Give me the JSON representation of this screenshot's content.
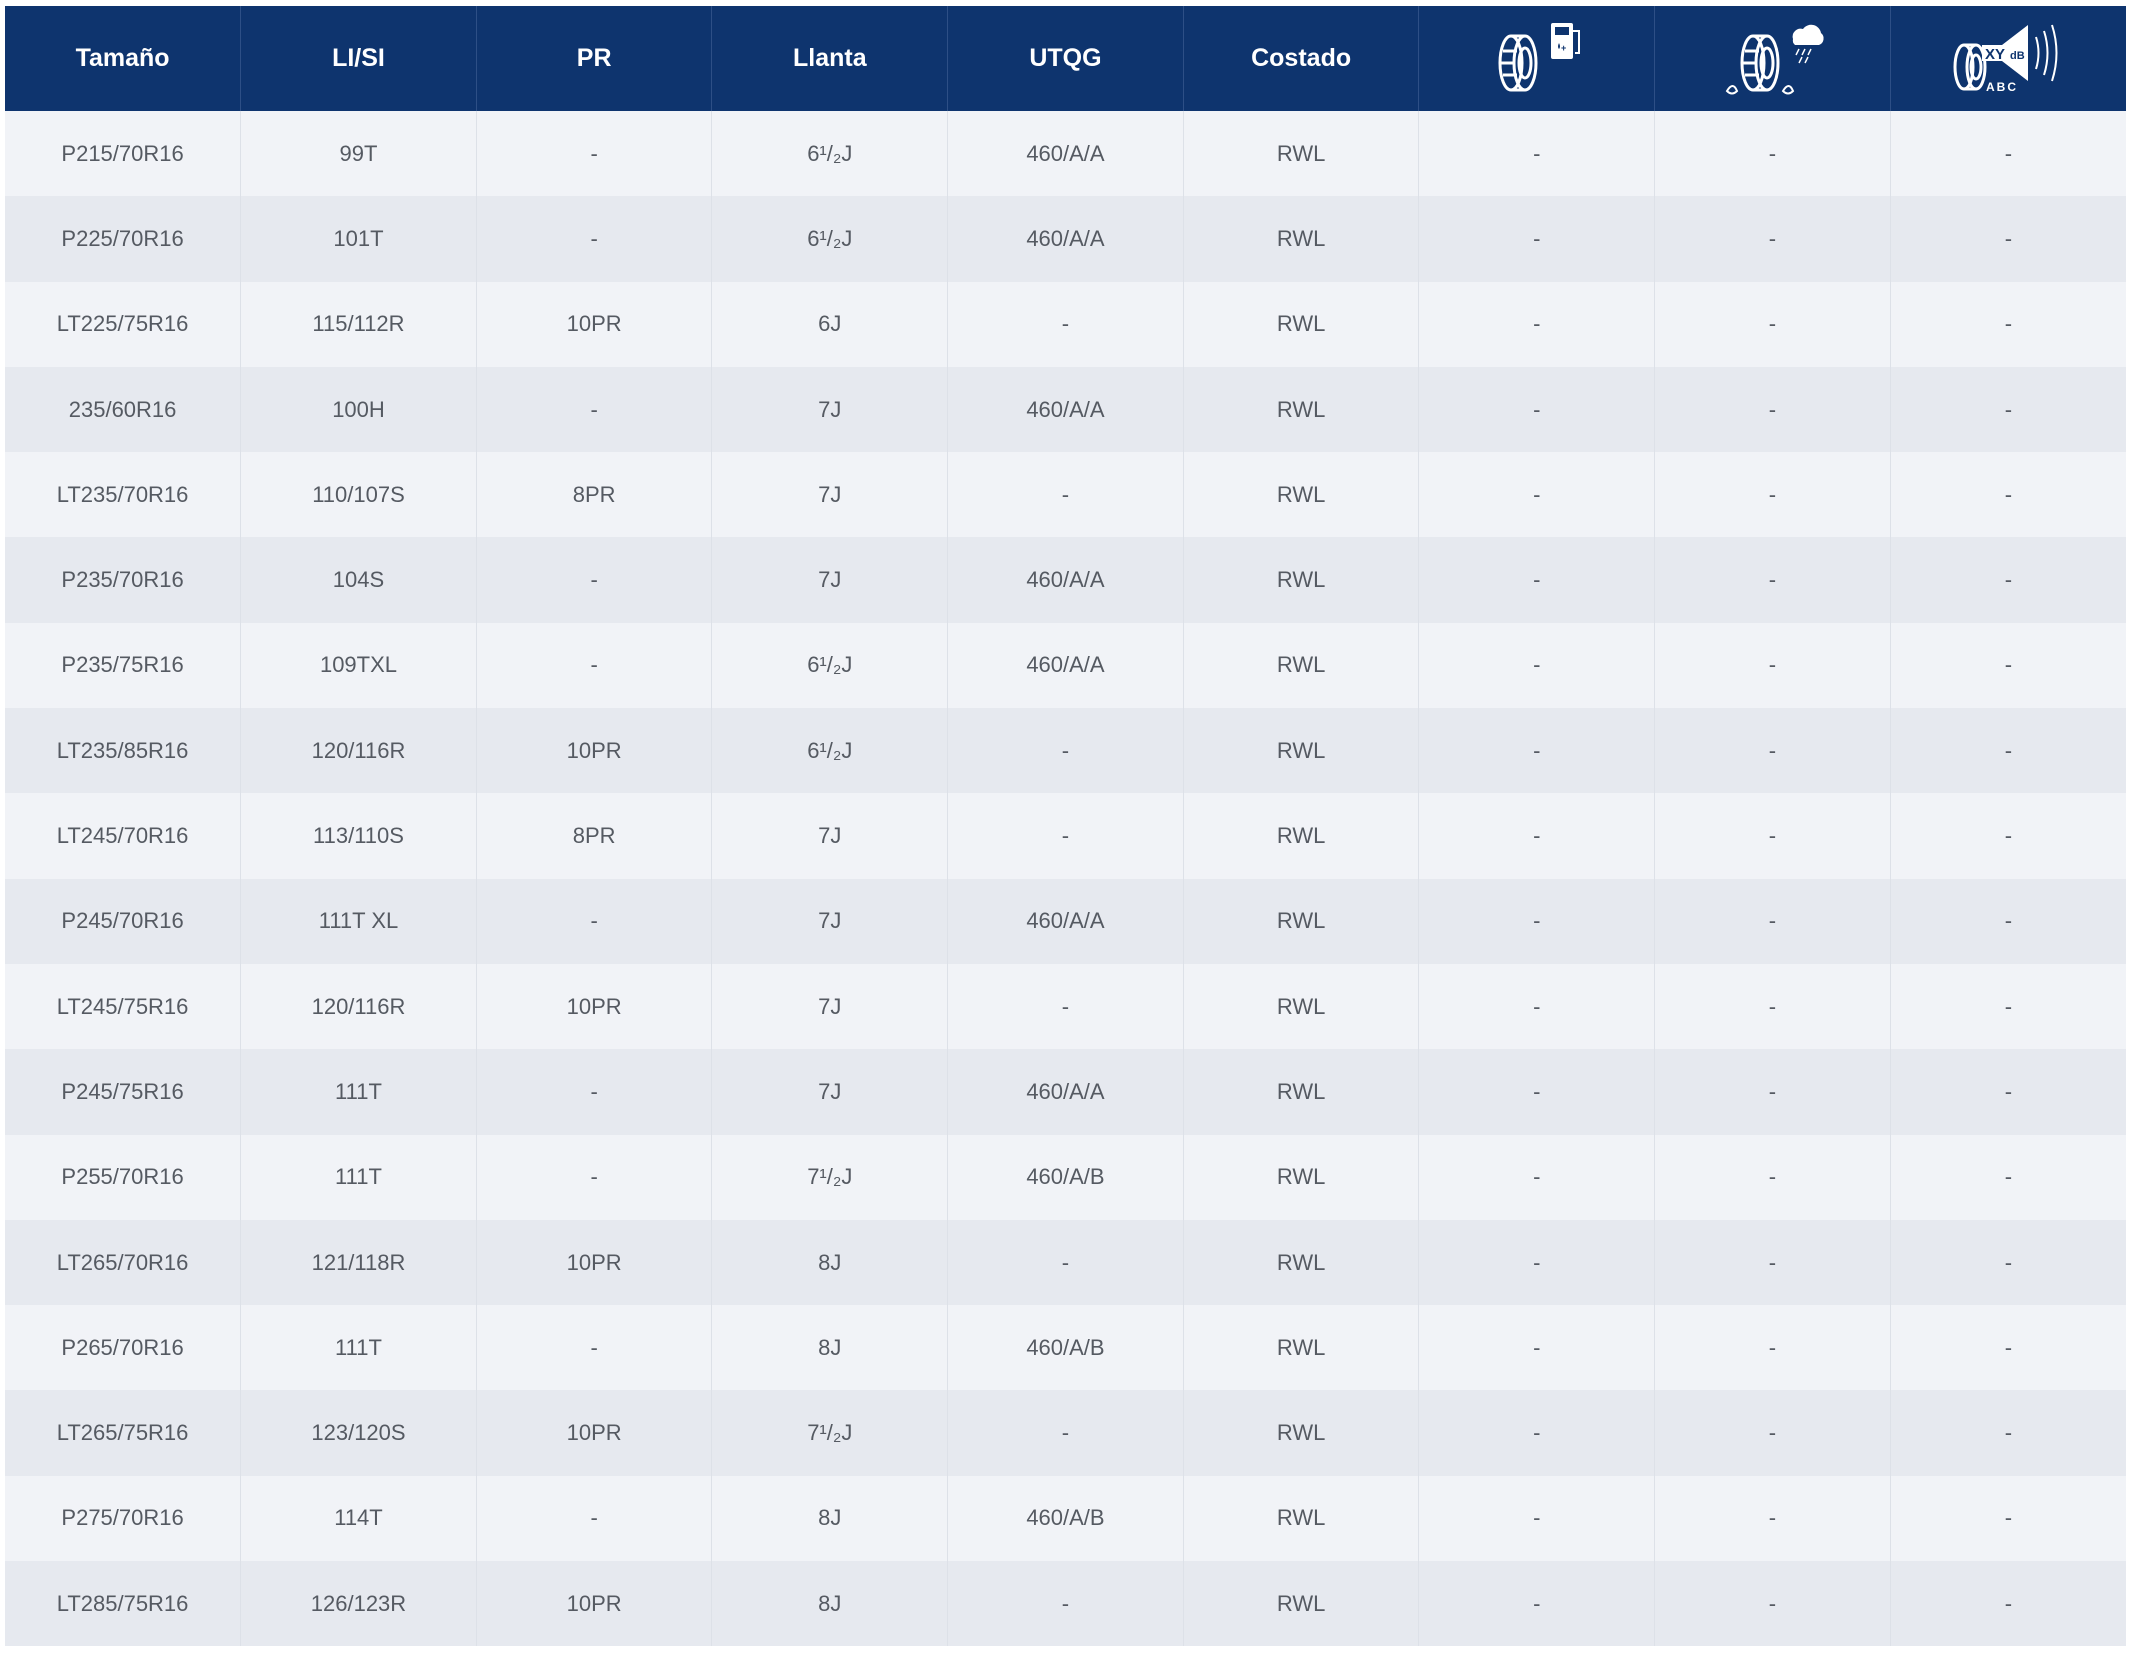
{
  "table": {
    "headers": [
      "Tamaño",
      "LI/SI",
      "PR",
      "Llanta",
      "UTQG",
      "Costado"
    ],
    "icon_headers": [
      {
        "icon": "tire-fuel-efficiency-icon"
      },
      {
        "icon": "tire-wet-grip-icon"
      },
      {
        "icon": "tire-noise-icon",
        "text_top": "XY",
        "unit": "dB",
        "classes": "ABC"
      }
    ],
    "colors": {
      "header_bg": "#0e346e",
      "row_odd": "#f1f3f7",
      "row_even": "#e6e9ef",
      "text": "#555a62"
    },
    "rows": [
      [
        "P215/70R16",
        "99T",
        "-",
        "6¹/₂J",
        "460/A/A",
        "RWL",
        "-",
        "-",
        "-"
      ],
      [
        "P225/70R16",
        "101T",
        "-",
        "6¹/₂J",
        "460/A/A",
        "RWL",
        "-",
        "-",
        "-"
      ],
      [
        "LT225/75R16",
        "115/112R",
        "10PR",
        "6J",
        "-",
        "RWL",
        "-",
        "-",
        "-"
      ],
      [
        "235/60R16",
        "100H",
        "-",
        "7J",
        "460/A/A",
        "RWL",
        "-",
        "-",
        "-"
      ],
      [
        "LT235/70R16",
        "110/107S",
        "8PR",
        "7J",
        "-",
        "RWL",
        "-",
        "-",
        "-"
      ],
      [
        "P235/70R16",
        "104S",
        "-",
        "7J",
        "460/A/A",
        "RWL",
        "-",
        "-",
        "-"
      ],
      [
        "P235/75R16",
        "109TXL",
        "-",
        "6¹/₂J",
        "460/A/A",
        "RWL",
        "-",
        "-",
        "-"
      ],
      [
        "LT235/85R16",
        "120/116R",
        "10PR",
        "6¹/₂J",
        "-",
        "RWL",
        "-",
        "-",
        "-"
      ],
      [
        "LT245/70R16",
        "113/110S",
        "8PR",
        "7J",
        "-",
        "RWL",
        "-",
        "-",
        "-"
      ],
      [
        "P245/70R16",
        "111T XL",
        "-",
        "7J",
        "460/A/A",
        "RWL",
        "-",
        "-",
        "-"
      ],
      [
        "LT245/75R16",
        "120/116R",
        "10PR",
        "7J",
        "-",
        "RWL",
        "-",
        "-",
        "-"
      ],
      [
        "P245/75R16",
        "111T",
        "-",
        "7J",
        "460/A/A",
        "RWL",
        "-",
        "-",
        "-"
      ],
      [
        "P255/70R16",
        "111T",
        "-",
        "7¹/₂J",
        "460/A/B",
        "RWL",
        "-",
        "-",
        "-"
      ],
      [
        "LT265/70R16",
        "121/118R",
        "10PR",
        "8J",
        "-",
        "RWL",
        "-",
        "-",
        "-"
      ],
      [
        "P265/70R16",
        "111T",
        "-",
        "8J",
        "460/A/B",
        "RWL",
        "-",
        "-",
        "-"
      ],
      [
        "LT265/75R16",
        "123/120S",
        "10PR",
        "7¹/₂J",
        "-",
        "RWL",
        "-",
        "-",
        "-"
      ],
      [
        "P275/70R16",
        "114T",
        "-",
        "8J",
        "460/A/B",
        "RWL",
        "-",
        "-",
        "-"
      ],
      [
        "LT285/75R16",
        "126/123R",
        "10PR",
        "8J",
        "-",
        "RWL",
        "-",
        "-",
        "-"
      ]
    ]
  }
}
